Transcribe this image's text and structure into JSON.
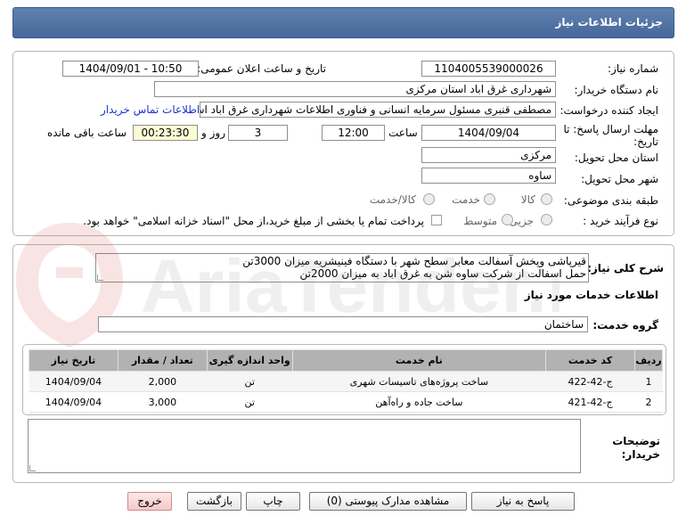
{
  "header": {
    "title": "جزئیات اطلاعات نیاز"
  },
  "form": {
    "need_number_label": "شماره نیاز:",
    "need_number": "1104005539000026",
    "announce_label": "تاریخ و ساعت اعلان عمومی:",
    "announce_value": "1404/09/01 - 10:50",
    "buyer_label": "نام دستگاه خریدار:",
    "buyer_value": "شهرداری غرق اباد استان مرکزی",
    "creator_label": "ایجاد کننده درخواست:",
    "creator_value": "مصطفی قنبری مسئول سرمایه انسانی و فناوری اطلاعات شهرداری غرق اباد اس",
    "contact_link": "اطلاعات تماس خریدار",
    "deadline_label_1": "مهلت ارسال پاسخ: تا",
    "deadline_label_2": "تاریخ:",
    "deadline_date": "1404/09/04",
    "time_label": "ساعت",
    "deadline_time": "12:00",
    "days_value": "3",
    "days_label": "روز و",
    "remaining_time": "00:23:30",
    "remaining_label": "ساعت باقی مانده",
    "province_label": "استان محل تحویل:",
    "province_value": "مرکزی",
    "city_label": "شهر محل تحویل:",
    "city_value": "ساوه",
    "category_label": "طبقه بندی موضوعی:",
    "category_options": [
      "کالا",
      "خدمت",
      "کالا/خدمت"
    ],
    "purchase_type_label": "نوع فرآیند خرید :",
    "purchase_options": [
      "جزیی",
      "متوسط"
    ],
    "payment_note": "پرداخت تمام یا بخشی از مبلغ خرید،از محل \"اسناد خزانه اسلامی\" خواهد بود."
  },
  "description": {
    "label": "شرح کلی نیاز:",
    "line1": "قیرپاشی وپخش آسفالت معابر سطح شهر با دستگاه فینیشریه میزان 3000تن",
    "line2": "حمل اسفالت از شرکت ساوه شن به غرق اباد به میزان 2000تن"
  },
  "services": {
    "section_title": "اطلاعات خدمات مورد نیاز",
    "group_label": "گروه خدمت:",
    "group_value": "ساختمان",
    "columns": [
      "ردیف",
      "کد خدمت",
      "نام خدمت",
      "واحد اندازه گیری",
      "تعداد / مقدار",
      "تاریخ نیاز"
    ],
    "rows": [
      {
        "index": "1",
        "code": "ج-42-422",
        "name": "ساخت پروژه‌های تاسیسات شهری",
        "unit": "تن",
        "qty": "2,000",
        "date": "1404/09/04"
      },
      {
        "index": "2",
        "code": "ج-42-421",
        "name": "ساخت جاده و راه‌آهن",
        "unit": "تن",
        "qty": "3,000",
        "date": "1404/09/04"
      }
    ]
  },
  "buyer_notes": {
    "label_1": "توضیحات",
    "label_2": "خریدار:",
    "value": ""
  },
  "buttons": {
    "reply": "پاسخ به نیاز",
    "attachments": "مشاهده مدارک پیوستی (0)",
    "print": "چاپ",
    "back": "بازگشت",
    "exit": "خروج"
  },
  "watermark_text": "AriaTender.net",
  "colors": {
    "header": "#5474a6",
    "link": "#1a33cc",
    "table_header": "#b2b2b2",
    "exit_button": "#f7c9c9"
  }
}
